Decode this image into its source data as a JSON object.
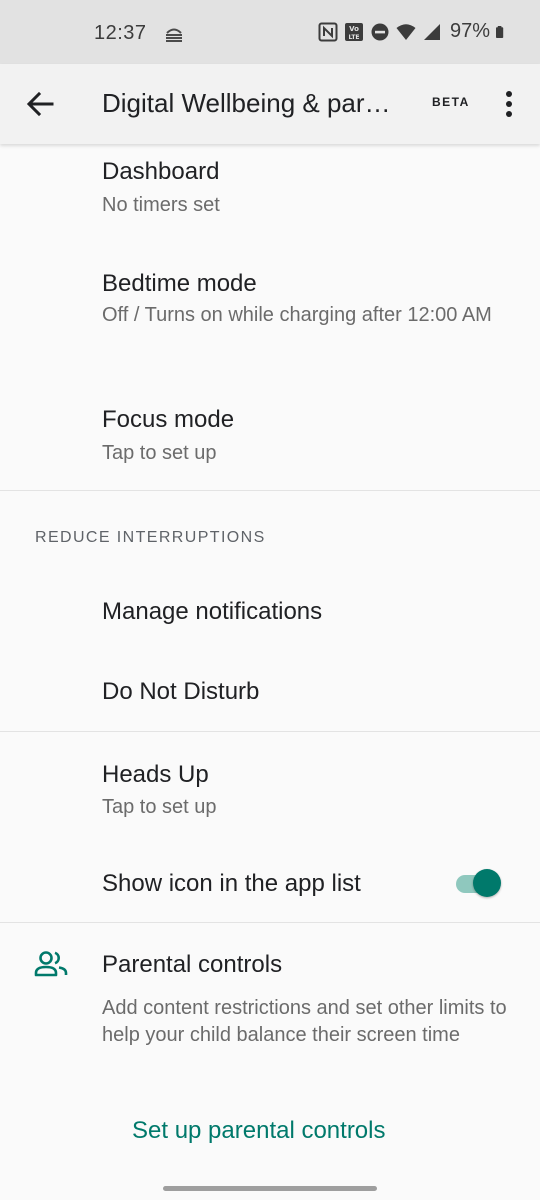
{
  "status_bar": {
    "time": "12:37",
    "battery": "97%",
    "icons": [
      "bookmark-stack-icon",
      "nfc-icon",
      "volte-icon",
      "dnd-icon",
      "wifi-icon",
      "signal-icon",
      "battery-icon"
    ]
  },
  "app_bar": {
    "title": "Digital Wellbeing & parental controls",
    "badge": "BETA"
  },
  "items": {
    "dashboard": {
      "title": "Dashboard",
      "subtitle": "No timers set"
    },
    "bedtime": {
      "title": "Bedtime mode",
      "subtitle": "Off / Turns on while charging after 12:00 AM"
    },
    "focus": {
      "title": "Focus mode",
      "subtitle": "Tap to set up"
    },
    "section_reduce": "REDUCE INTERRUPTIONS",
    "notifications": {
      "title": "Manage notifications"
    },
    "dnd": {
      "title": "Do Not Disturb"
    },
    "heads_up": {
      "title": "Heads Up",
      "subtitle": "Tap to set up"
    },
    "show_icon": {
      "title": "Show icon in the app list",
      "enabled": true
    },
    "parental": {
      "title": "Parental controls",
      "subtitle": "Add content restrictions and set other limits to help your child balance their screen time",
      "action": "Set up parental controls"
    }
  },
  "colors": {
    "accent": "#00796b",
    "toggle_track": "#8fc8be"
  }
}
